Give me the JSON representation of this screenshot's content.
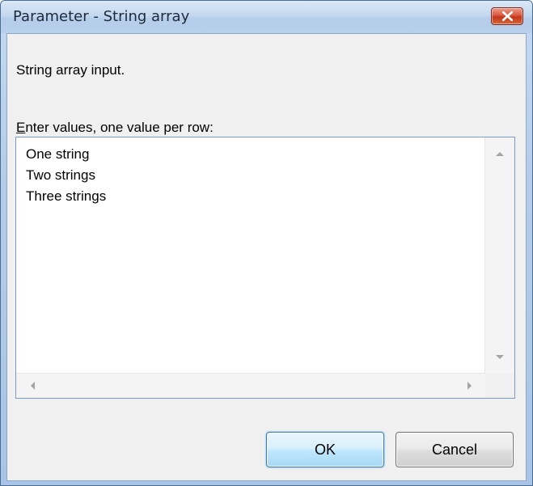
{
  "window": {
    "title": "Parameter - String array",
    "close_icon": "close-icon"
  },
  "dialog": {
    "description": "String array input.",
    "values_label_mnemonic": "E",
    "values_label_rest": "nter values, one value per row:",
    "values": [
      "One string",
      "Two strings",
      "Three strings"
    ]
  },
  "buttons": {
    "ok_label": "OK",
    "cancel_label": "Cancel"
  },
  "colors": {
    "close_button": "#c53719",
    "ok_button_border": "#3c7fb1",
    "dialog_background": "#f0f0f0"
  }
}
